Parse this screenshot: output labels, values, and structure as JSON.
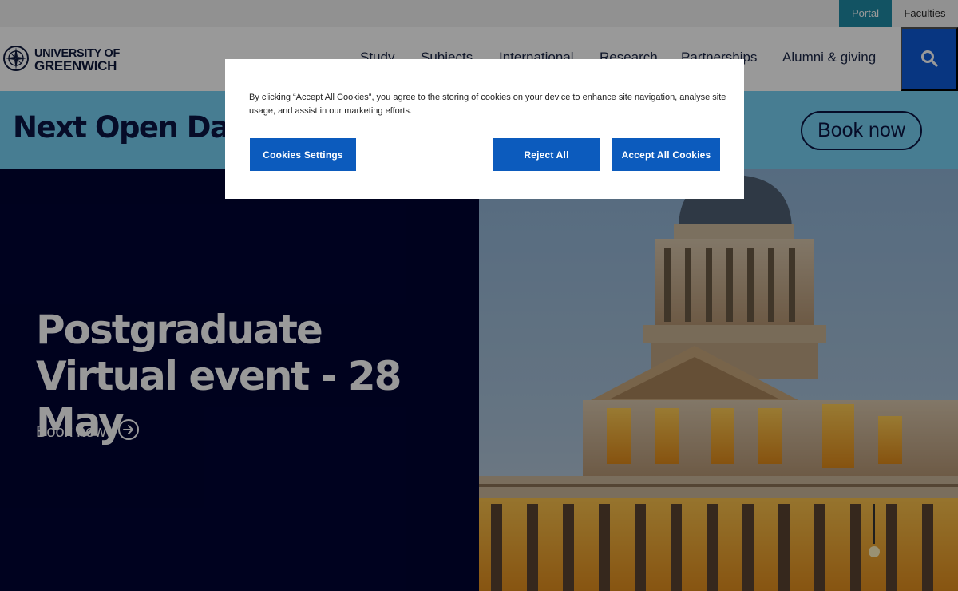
{
  "utility": {
    "portal": "Portal",
    "faculties": "Faculties"
  },
  "logo": {
    "line1": "UNIVERSITY OF",
    "line2": "GREENWICH"
  },
  "nav": {
    "items": [
      "Study",
      "Subjects",
      "International",
      "Research",
      "Partnerships",
      "Alumni & giving"
    ]
  },
  "search": {
    "icon": "search-icon"
  },
  "openday": {
    "title": "Next Open Day",
    "button": "Book now"
  },
  "hero": {
    "title": "Postgraduate Virtual event - 28 May",
    "link": "Book now",
    "link_icon": "arrow-circle-right-icon"
  },
  "cookie": {
    "text": "By clicking “Accept All Cookies”, you agree to the storing of cookies on your device to enhance site navigation, analyse site usage, and assist in our marketing efforts.",
    "settings": "Cookies Settings",
    "reject": "Reject All",
    "accept": "Accept All Cookies"
  },
  "colors": {
    "brand_blue": "#0e5bd8",
    "banner_cyan": "#77d1f3",
    "hero_navy": "#000433",
    "cookie_button": "#0c5bbd",
    "portal_teal": "#1f8aa5"
  }
}
